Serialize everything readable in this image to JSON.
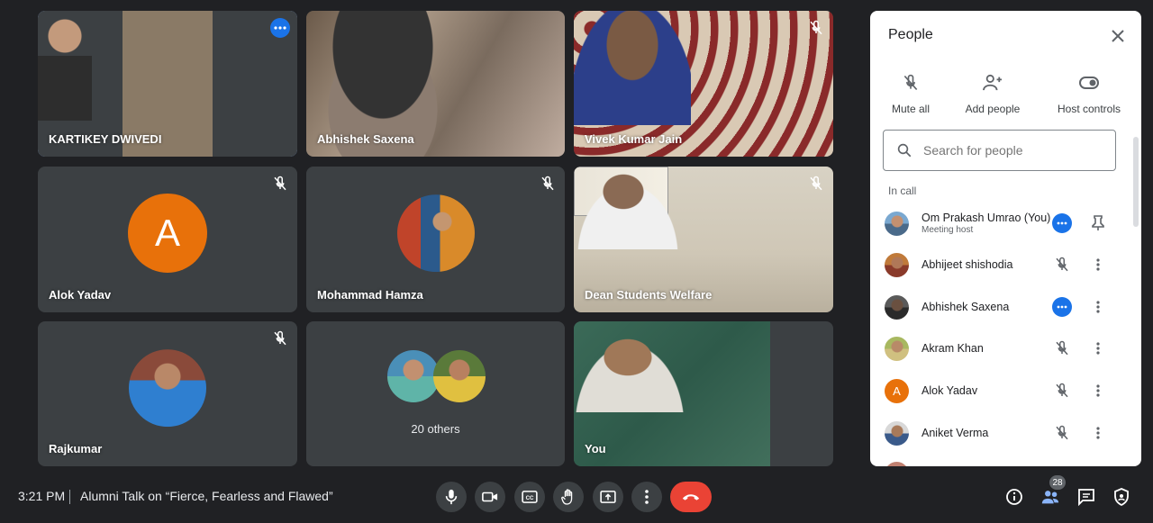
{
  "tiles": [
    {
      "name": "KARTIKEY DWIVEDI",
      "kind": "video",
      "active": true
    },
    {
      "name": "Abhishek Saxena",
      "kind": "video"
    },
    {
      "name": "Vivek Kumar Jain",
      "kind": "video",
      "muted": true
    },
    {
      "name": "Alok Yadav",
      "kind": "letter",
      "letter": "A",
      "muted": true
    },
    {
      "name": "Mohammad Hamza",
      "kind": "photo",
      "muted": true
    },
    {
      "name": "Dean Students Welfare",
      "kind": "video",
      "muted": true
    },
    {
      "name": "Rajkumar",
      "kind": "photo",
      "muted": true
    },
    {
      "name": "20 others",
      "kind": "group"
    },
    {
      "name": "You",
      "kind": "video"
    }
  ],
  "panel": {
    "title": "People",
    "actions": [
      "Mute all",
      "Add people",
      "Host controls"
    ],
    "search_placeholder": "Search for people",
    "section": "In call",
    "people": [
      {
        "name": "Om Prakash Umrao (You)",
        "sub": "Meeting host",
        "state": "speaking"
      },
      {
        "name": "Abhijeet shishodia",
        "state": "muted"
      },
      {
        "name": "Abhishek Saxena",
        "state": "speaking"
      },
      {
        "name": "Akram Khan",
        "state": "muted"
      },
      {
        "name": "Alok Yadav",
        "state": "muted",
        "letter": "A"
      },
      {
        "name": "Aniket Verma",
        "state": "muted"
      }
    ]
  },
  "bottom": {
    "time": "3:21 PM",
    "meeting_title": "Alumni Talk on “Fierce, Fearless and Flawed”",
    "people_count": "28"
  },
  "colors": {
    "accent": "#8ab4f8",
    "end_call": "#ea4335",
    "avatar_orange": "#e8710a",
    "speaking_blue": "#1a73e8"
  }
}
